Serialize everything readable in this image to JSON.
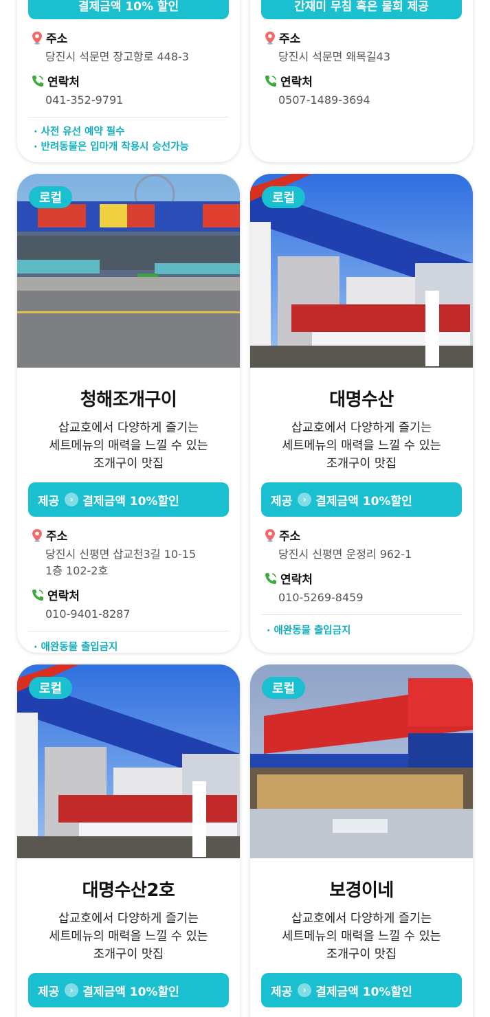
{
  "badge_label": "로컬",
  "benefit_prefix": "제공",
  "address_label": "주소",
  "contact_label": "연락처",
  "top_cards": [
    {
      "benefit": "결제금액 10% 할인",
      "address": "당진시 석문면 장고항로 448-3",
      "phone": "041-352-9791",
      "notes": [
        "· 사전 유선 예약 필수",
        "· 반려동물은 입마개 착용시 승선가능"
      ]
    },
    {
      "benefit": "간재미 무침 혹은 물회 제공",
      "address": "당진시 석문면 왜목길43",
      "phone": "0507-1489-3694"
    }
  ],
  "cards": [
    {
      "name": "청해조개구이",
      "desc": [
        "삽교호에서 다양하게 즐기는",
        "세트메뉴의 매력을 느낄 수 있는",
        "조개구이 맛집"
      ],
      "benefit": "결제금액 10%할인",
      "address": [
        "당진시 신평면 삽교천3길 10-15",
        "1층 102-2호"
      ],
      "phone": "010-9401-8287",
      "note": "· 애완동물 출입금지"
    },
    {
      "name": "대명수산",
      "desc": [
        "삽교호에서 다양하게 즐기는",
        "세트메뉴의 매력을 느낄 수 있는",
        "조개구이 맛집"
      ],
      "benefit": "결제금액 10%할인",
      "address": [
        "당진시 신평면 운정리 962-1"
      ],
      "phone": "010-5269-8459",
      "note": "· 애완동물 출입금지"
    },
    {
      "name": "대명수산2호",
      "desc": [
        "삽교호에서 다양하게 즐기는",
        "세트메뉴의 매력을 느낄 수 있는",
        "조개구이 맛집"
      ],
      "benefit": "결제금액 10%할인"
    },
    {
      "name": "보경이네",
      "desc": [
        "삽교호에서 다양하게 즐기는",
        "세트메뉴의 매력을 느낄 수 있는",
        "조개구이 맛집"
      ],
      "benefit": "결제금액 10%할인"
    }
  ],
  "colors": {
    "accent": "#1ac0cf",
    "note_text": "#12aebd"
  },
  "icons": {
    "address": "map-pin-icon",
    "contact": "phone-icon",
    "benefit": "chevron-right-icon"
  }
}
